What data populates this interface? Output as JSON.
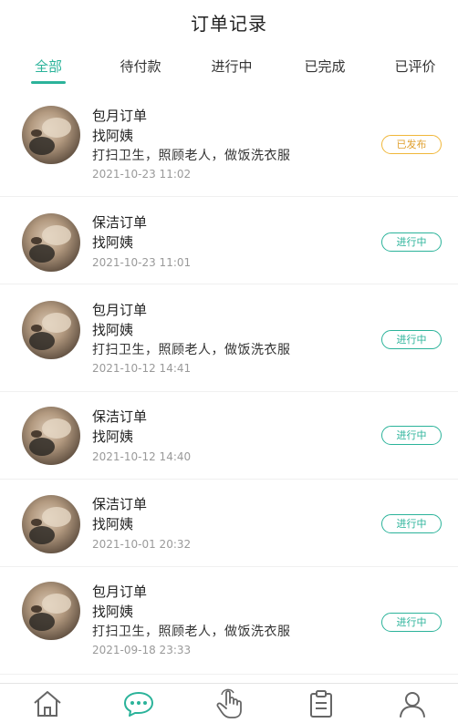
{
  "header": {
    "title": "订单记录"
  },
  "tabs": [
    {
      "label": "全部",
      "active": true
    },
    {
      "label": "待付款",
      "active": false
    },
    {
      "label": "进行中",
      "active": false
    },
    {
      "label": "已完成",
      "active": false
    },
    {
      "label": "已评价",
      "active": false
    }
  ],
  "orders": [
    {
      "type": "包月订单",
      "who": "找阿姨",
      "desc": "打扫卫生，照顾老人，做饭洗衣服",
      "time": "2021-10-23 11:02",
      "status": "已发布",
      "status_color": "#f0b73a"
    },
    {
      "type": "保洁订单",
      "who": "找阿姨",
      "desc": "",
      "time": "2021-10-23 11:01",
      "status": "进行中",
      "status_color": "#2bb39a"
    },
    {
      "type": "包月订单",
      "who": "找阿姨",
      "desc": "打扫卫生，照顾老人，做饭洗衣服",
      "time": "2021-10-12 14:41",
      "status": "进行中",
      "status_color": "#2bb39a"
    },
    {
      "type": "保洁订单",
      "who": "找阿姨",
      "desc": "",
      "time": "2021-10-12 14:40",
      "status": "进行中",
      "status_color": "#2bb39a"
    },
    {
      "type": "保洁订单",
      "who": "找阿姨",
      "desc": "",
      "time": "2021-10-01 20:32",
      "status": "进行中",
      "status_color": "#2bb39a"
    },
    {
      "type": "包月订单",
      "who": "找阿姨",
      "desc": "打扫卫生，照顾老人，做饭洗衣服",
      "time": "2021-09-18 23:33",
      "status": "进行中",
      "status_color": "#2bb39a"
    }
  ],
  "bottom_nav": [
    {
      "icon": "home-icon",
      "active": false
    },
    {
      "icon": "message-icon",
      "active": true
    },
    {
      "icon": "tap-hand-icon",
      "active": false
    },
    {
      "icon": "clipboard-icon",
      "active": false
    },
    {
      "icon": "user-icon",
      "active": false
    }
  ],
  "colors": {
    "accent": "#2bb39a",
    "warning": "#f0b73a",
    "muted_text": "#9a9a9a"
  }
}
